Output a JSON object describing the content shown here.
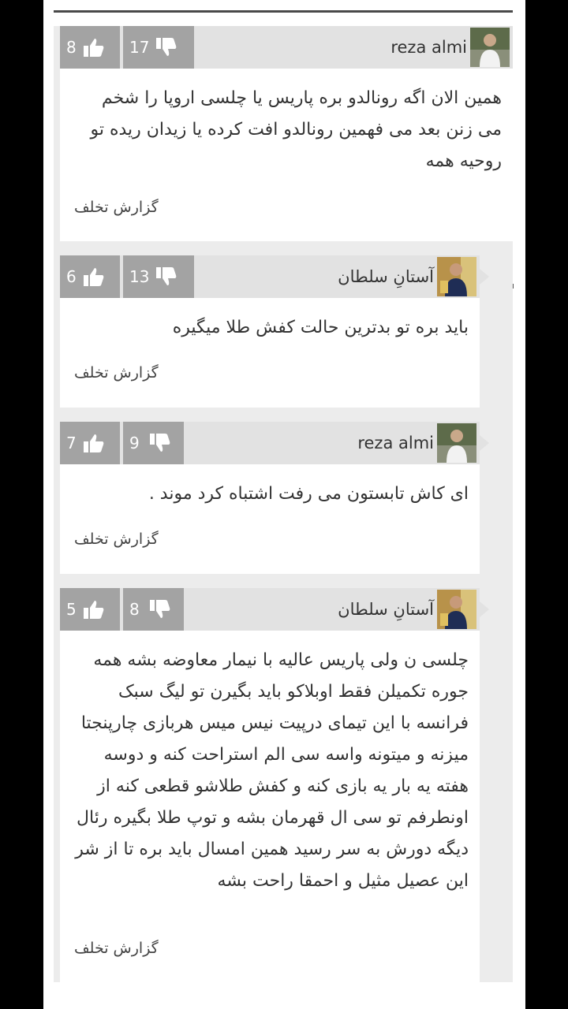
{
  "comments": [
    {
      "author": "reza almi",
      "dislikes": "17",
      "likes": "8",
      "text": "همین الان اگه رونالدو بره پاریس یا چلسی اروپا را شخم می زنن بعد می فهمین رونالدو افت کرده یا زیدان ریده تو روحیه همه",
      "report": "گزارش تخلف"
    },
    {
      "author": "آستانِ سلطان",
      "dislikes": "13",
      "likes": "6",
      "text": "باید بره تو بدترین حالت کفش طلا میگیره",
      "report": "گزارش تخلف"
    },
    {
      "author": "reza almi",
      "dislikes": "9",
      "likes": "7",
      "text": "ای کاش تابستون می رفت اشتباه کرد موند .",
      "report": "گزارش تخلف"
    },
    {
      "author": "آستانِ سلطان",
      "dislikes": "8",
      "likes": "5",
      "text": "چلسی ن ولی پاریس عالیه با نیمار معاوضه بشه همه جوره تکمیلن فقط اوبلاکو باید بگیرن تو لیگ سبک فرانسه با این تیمای درپیت نیس میس هربازی چارپنجتا میزنه و میتونه واسه سی الم استراحت کنه و دوسه هفته یه بار یه بازی کنه و کفش طلاشو قطعی کنه از اونطرفم تو سی ال قهرمان بشه و توپ طلا بگیره رئال دیگه دورش به سر رسید همین امسال باید بره تا از شر این عصیل مثیل و احمقا راحت بشه",
      "report": "گزارش تخلف"
    }
  ],
  "icons": {
    "like": "thumbs-up-icon",
    "dislike": "thumbs-down-icon",
    "reply_arrow": "arrow-left-icon"
  },
  "colors": {
    "header": "#e2e2e2",
    "vote_box": "#a3a3a3",
    "text": "#333333"
  }
}
